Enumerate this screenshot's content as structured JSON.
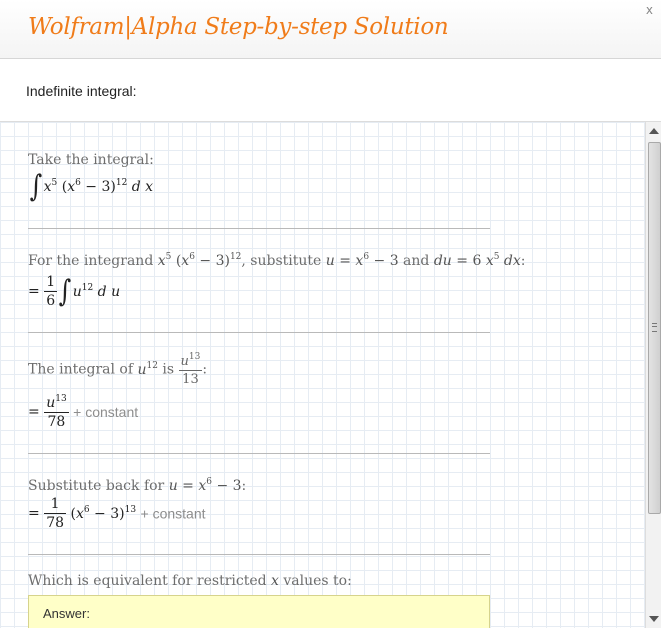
{
  "window": {
    "title": "Wolfram|Alpha Step-by-step Solution",
    "close_label": "x"
  },
  "problem": {
    "label": "Indefinite integral:"
  },
  "steps": [
    {
      "text": "Take the integral:",
      "formula": "∫x⁵ (x⁶ − 3)¹² dx"
    },
    {
      "text_parts": [
        "For the integrand ",
        ", substitute ",
        " and ",
        ":"
      ],
      "integrand": "x⁵ (x⁶ − 3)¹²",
      "substitution": "u = x⁶ − 3",
      "differential": "du = 6 x⁵ dx",
      "formula": "= 1/6 ∫u¹² du"
    },
    {
      "text_parts": [
        "The integral of ",
        " is ",
        ":"
      ],
      "term": "u¹²",
      "result": "u¹³/13",
      "formula": "= u¹³/78 + constant"
    },
    {
      "text_parts": [
        "Substitute back for ",
        ":"
      ],
      "substitution": "u = x⁶ − 3",
      "formula": "= 1/78 (x⁶ − 3)¹³ + constant"
    },
    {
      "text_parts": [
        "Which is equivalent for restricted ",
        " values to:"
      ],
      "variable": "x"
    }
  ],
  "constant_label": "+ constant",
  "answer": {
    "label": "Answer:"
  },
  "colors": {
    "brand_orange": "#f07c1a",
    "answer_bg": "#ffffc8",
    "grid_line": "#e6ecf3"
  },
  "icons": [
    "close-icon",
    "scroll-up-arrow-icon",
    "scroll-down-arrow-icon",
    "scroll-grip-icon"
  ]
}
